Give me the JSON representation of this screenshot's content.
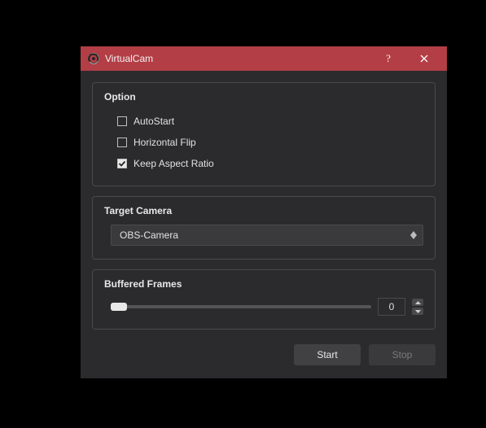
{
  "window": {
    "title": "VirtualCam"
  },
  "options": {
    "group_title": "Option",
    "autostart": {
      "label": "AutoStart",
      "checked": false
    },
    "hflip": {
      "label": "Horizontal Flip",
      "checked": false
    },
    "keep_aspect": {
      "label": "Keep Aspect Ratio",
      "checked": true
    }
  },
  "target_camera": {
    "group_title": "Target Camera",
    "selected": "OBS-Camera"
  },
  "buffered_frames": {
    "group_title": "Buffered Frames",
    "value": "0"
  },
  "buttons": {
    "start": "Start",
    "stop": "Stop"
  }
}
